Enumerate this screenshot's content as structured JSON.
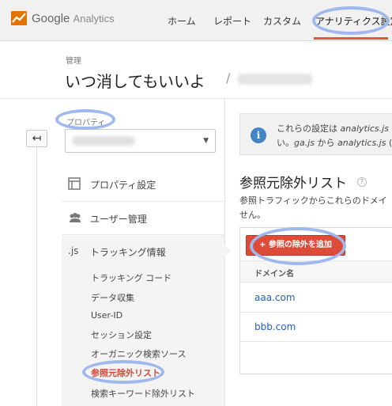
{
  "brand": {
    "name": "Google",
    "product": "Analytics"
  },
  "nav": {
    "home": "ホーム",
    "report": "レポート",
    "custom": "カスタム",
    "admin": "アナリティクス設定"
  },
  "header": {
    "breadcrumb": "管理",
    "title": "いつ消してもいいよ",
    "title_separator": "/"
  },
  "sidebar": {
    "back_icon": "↤",
    "property_label": "プロパティ",
    "menu": [
      {
        "label": "プロパティ設定",
        "icon": "property-icon"
      },
      {
        "label": "ユーザー管理",
        "icon": "users-icon"
      },
      {
        "label": "トラッキング情報",
        "icon": "js-icon",
        "icon_text": ".js"
      }
    ],
    "sub_items": [
      "トラッキング コード",
      "データ収集",
      "User-ID",
      "セッション設定",
      "オーガニック検索ソース",
      "参照元除外リスト",
      "検索キーワード除外リスト"
    ]
  },
  "info": {
    "line1_prefix": "これらの設定は ",
    "line1_code": "analytics.js",
    "line2_prefix": "い。",
    "line2_code1": "ga.js",
    "line2_mid": " から ",
    "line2_code2": "analytics.js",
    "line2_suffix": " ("
  },
  "section": {
    "title": "参照元除外リスト",
    "help": "?",
    "desc1": "参照トラフィックからこれらのドメイ",
    "desc2": "せん。"
  },
  "table": {
    "add_button": "+ 参照の除外を追加",
    "column_domain": "ドメイン名",
    "rows": [
      "aaa.com",
      "bbb.com"
    ]
  },
  "colors": {
    "accent": "#dd4b39",
    "link": "#2260c4",
    "highlight": "#9fb9ef",
    "info_icon": "#4285c6"
  }
}
